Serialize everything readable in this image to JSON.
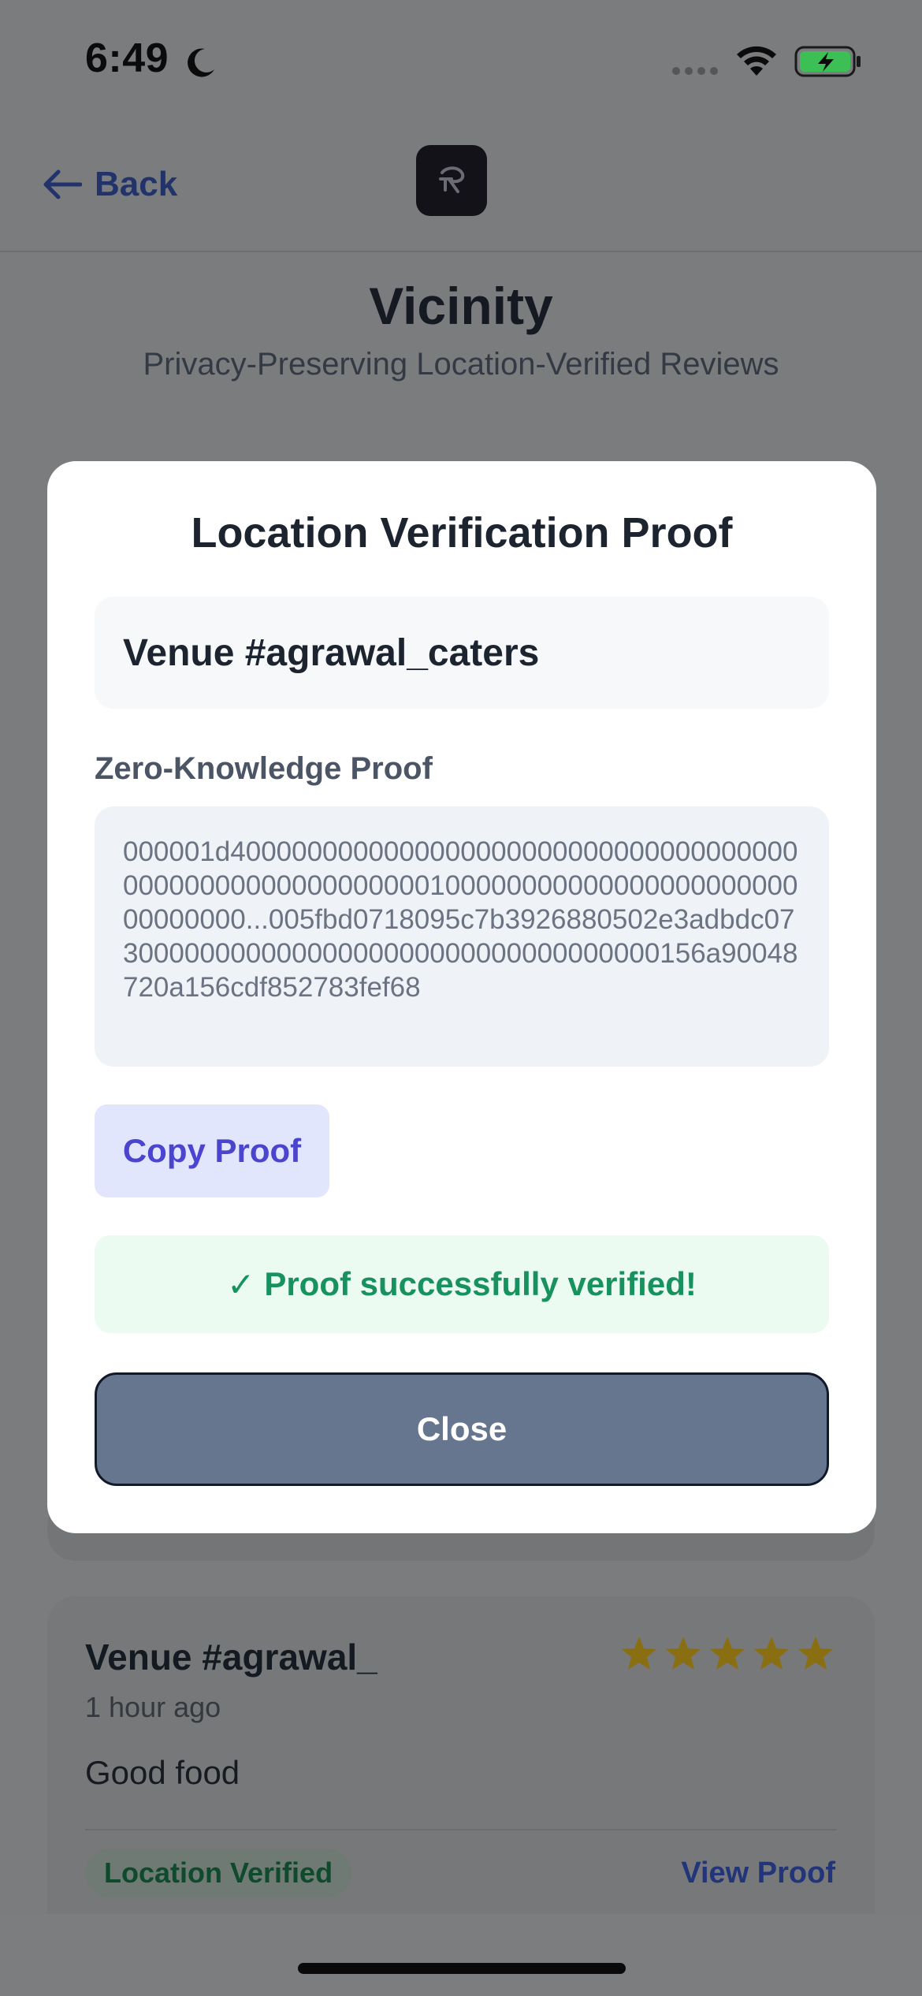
{
  "status_bar": {
    "time": "6:49"
  },
  "nav": {
    "back_label": "Back"
  },
  "header": {
    "title": "Vicinity",
    "subtitle": "Privacy-Preserving Location-Verified Reviews"
  },
  "modal": {
    "title": "Location Verification Proof",
    "venue": "Venue #agrawal_caters",
    "proof_label": "Zero-Knowledge Proof",
    "proof_text": "000001d40000000000000000000000000000000000000000000000000000000010000000000000000000000000000000...005fbd0718095c7b3926880502e3adbdc0730000000000000000000000000000000000156a90048720a156cdf852783fef68",
    "copy_button": "Copy Proof",
    "verified_message": "Proof successfully verified!",
    "verified_check": "✓",
    "close_button": "Close"
  },
  "review": {
    "venue": "Venue #agrawal_",
    "rating": 5,
    "time": "1 hour ago",
    "text": "Good food",
    "badge": "Location Verified",
    "view_proof": "View Proof"
  },
  "colors": {
    "accent": "#4b44cf",
    "success": "#17915e",
    "close_button": "#66768e",
    "star": "#d4a514"
  }
}
